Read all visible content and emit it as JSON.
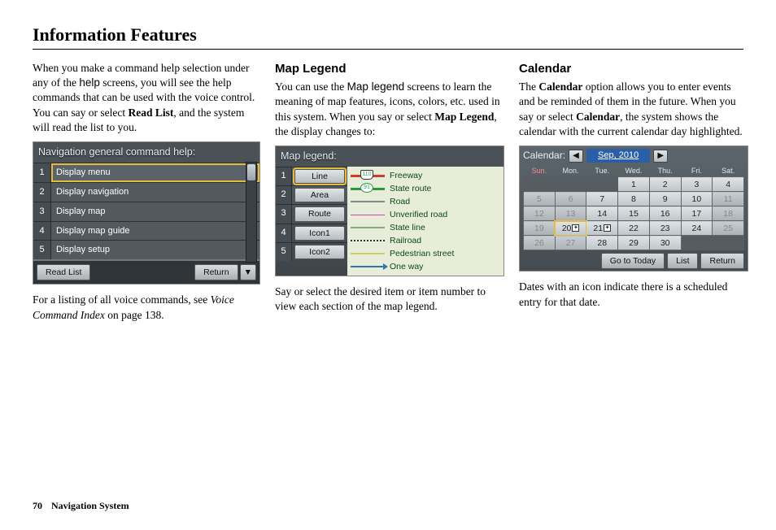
{
  "page_title": "Information Features",
  "footer": {
    "page": "70",
    "section": "Navigation System"
  },
  "col1": {
    "para1_a": "When you make a command help selection under any of the ",
    "para1_b": "help",
    "para1_c": " screens, you will see the help commands that can be used with the voice control. You can say or select ",
    "para1_d": "Read List",
    "para1_e": ", and the system will read the list to you.",
    "fig_title": "Navigation general command help:",
    "items": [
      "Display menu",
      "Display navigation",
      "Display map",
      "Display map guide",
      "Display setup"
    ],
    "read_list": "Read List",
    "return": "Return",
    "para2_a": "For a listing of all voice commands, see ",
    "para2_b": "Voice Command Index",
    "para2_c": " on page 138."
  },
  "col2": {
    "h": "Map Legend",
    "p1_a": "You can use the ",
    "p1_b": "Map legend",
    "p1_c": " screens to learn the meaning of map features, icons, colors, etc. used in this system. When you say or select ",
    "p1_d": "Map Legend",
    "p1_e": ", the display changes to:",
    "fig_title": "Map legend:",
    "buttons": [
      "Line",
      "Area",
      "Route",
      "Icon1",
      "Icon2"
    ],
    "legend": [
      {
        "label": "Freeway",
        "shield": "110"
      },
      {
        "label": "State route",
        "shield": "91"
      },
      {
        "label": "Road"
      },
      {
        "label": "Unverified road"
      },
      {
        "label": "State line"
      },
      {
        "label": "Railroad"
      },
      {
        "label": "Pedestrian street"
      },
      {
        "label": "One way"
      }
    ],
    "p2": "Say or select the desired item or item number to view each section of the map legend."
  },
  "col3": {
    "h": "Calendar",
    "p1_a": "The ",
    "p1_b": "Calendar",
    "p1_c": " option allows you to enter events and be reminded of them in the future. When you say or select ",
    "p1_d": "Calendar",
    "p1_e": ", the system shows the calendar with the current calendar day highlighted.",
    "fig_title": "Calendar:",
    "month": "Sep, 2010",
    "dow": [
      "Sun.",
      "Mon.",
      "Tue.",
      "Wed.",
      "Thu.",
      "Fri.",
      "Sat."
    ],
    "weeks": [
      [
        null,
        null,
        null,
        {
          "d": 1
        },
        {
          "d": 2
        },
        {
          "d": 3
        },
        {
          "d": 4
        }
      ],
      [
        {
          "d": 5,
          "dim": true
        },
        {
          "d": 6,
          "dim": true
        },
        {
          "d": 7
        },
        {
          "d": 8
        },
        {
          "d": 9
        },
        {
          "d": 10
        },
        {
          "d": 11,
          "dim": true
        }
      ],
      [
        {
          "d": 12,
          "dim": true
        },
        {
          "d": 13,
          "dim": true
        },
        {
          "d": 14
        },
        {
          "d": 15
        },
        {
          "d": 16
        },
        {
          "d": 17
        },
        {
          "d": 18,
          "dim": true
        }
      ],
      [
        {
          "d": 19,
          "dim": true
        },
        {
          "d": 20,
          "today": true,
          "evt": true
        },
        {
          "d": 21,
          "evt": true
        },
        {
          "d": 22
        },
        {
          "d": 23
        },
        {
          "d": 24
        },
        {
          "d": 25,
          "dim": true
        }
      ],
      [
        {
          "d": 26,
          "dim": true
        },
        {
          "d": 27,
          "dim": true
        },
        {
          "d": 28
        },
        {
          "d": 29
        },
        {
          "d": 30
        },
        null,
        null
      ]
    ],
    "go_today": "Go to Today",
    "list": "List",
    "return": "Return",
    "p2": "Dates with an icon indicate there is a scheduled entry for that date."
  }
}
